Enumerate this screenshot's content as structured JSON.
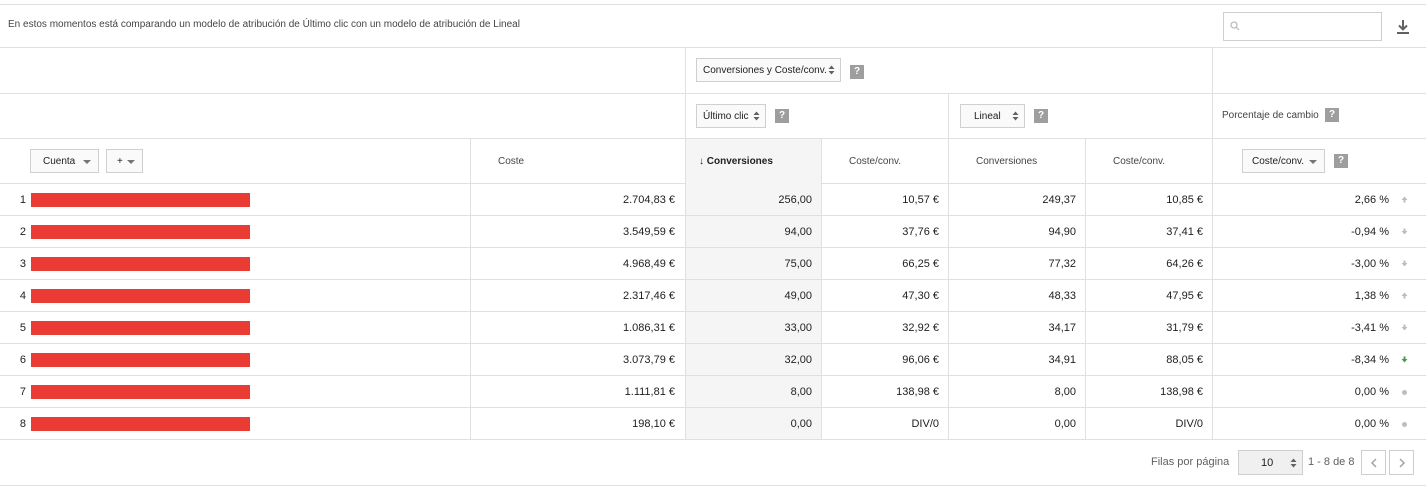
{
  "toolbar": {
    "search_value": "",
    "search_icon": "search-icon",
    "download_icon": "download-icon"
  },
  "info": {
    "comparison_text": "En estos momentos está comparando un modelo de atribución de Último clic con un modelo de atribución de Lineal",
    "metric_select": "Conversiones y Coste/conv.",
    "help": "?"
  },
  "models": {
    "model_a": "Último clic",
    "model_b": "Lineal",
    "change_label": "Porcentaje de cambio",
    "help": "?"
  },
  "columns": {
    "dimension_button": "Cuenta",
    "add_button": "+",
    "coste": "Coste",
    "conversions_sorted": "Conversiones",
    "sort_arrow": "↓",
    "coste_conv_a": "Coste/conv.",
    "conversions_b": "Conversiones",
    "coste_conv_b": "Coste/conv.",
    "change_metric": "Coste/conv.",
    "help": "?"
  },
  "colors": {
    "redaction": "#ea3b34",
    "dot_neutral": "#bdbdbd",
    "dot_positive": "#43a047"
  },
  "rows": [
    {
      "num": "1",
      "coste": "2.704,83 €",
      "conv_a": "256,00",
      "cpc_a": "10,57 €",
      "conv_b": "249,37",
      "cpc_b": "10,85 €",
      "change": "2,66 %",
      "indicator": "up-neutral"
    },
    {
      "num": "2",
      "coste": "3.549,59 €",
      "conv_a": "94,00",
      "cpc_a": "37,76 €",
      "conv_b": "94,90",
      "cpc_b": "37,41 €",
      "change": "-0,94 %",
      "indicator": "down-neutral"
    },
    {
      "num": "3",
      "coste": "4.968,49 €",
      "conv_a": "75,00",
      "cpc_a": "66,25 €",
      "conv_b": "77,32",
      "cpc_b": "64,26 €",
      "change": "-3,00 %",
      "indicator": "down-neutral"
    },
    {
      "num": "4",
      "coste": "2.317,46 €",
      "conv_a": "49,00",
      "cpc_a": "47,30 €",
      "conv_b": "48,33",
      "cpc_b": "47,95 €",
      "change": "1,38 %",
      "indicator": "up-neutral"
    },
    {
      "num": "5",
      "coste": "1.086,31 €",
      "conv_a": "33,00",
      "cpc_a": "32,92 €",
      "conv_b": "34,17",
      "cpc_b": "31,79 €",
      "change": "-3,41 %",
      "indicator": "down-neutral"
    },
    {
      "num": "6",
      "coste": "3.073,79 €",
      "conv_a": "32,00",
      "cpc_a": "96,06 €",
      "conv_b": "34,91",
      "cpc_b": "88,05 €",
      "change": "-8,34 %",
      "indicator": "down-positive"
    },
    {
      "num": "7",
      "coste": "1.111,81 €",
      "conv_a": "8,00",
      "cpc_a": "138,98 €",
      "conv_b": "8,00",
      "cpc_b": "138,98 €",
      "change": "0,00 %",
      "indicator": "neutral"
    },
    {
      "num": "8",
      "coste": "198,10 €",
      "conv_a": "0,00",
      "cpc_a": "DIV/0",
      "conv_b": "0,00",
      "cpc_b": "DIV/0",
      "change": "0,00 %",
      "indicator": "neutral"
    }
  ],
  "footer": {
    "rows_per_page_label": "Filas por página",
    "rows_per_page_value": "10",
    "range": "1 - 8 de 8",
    "prev_icon": "chevron-left-icon",
    "next_icon": "chevron-right-icon"
  }
}
